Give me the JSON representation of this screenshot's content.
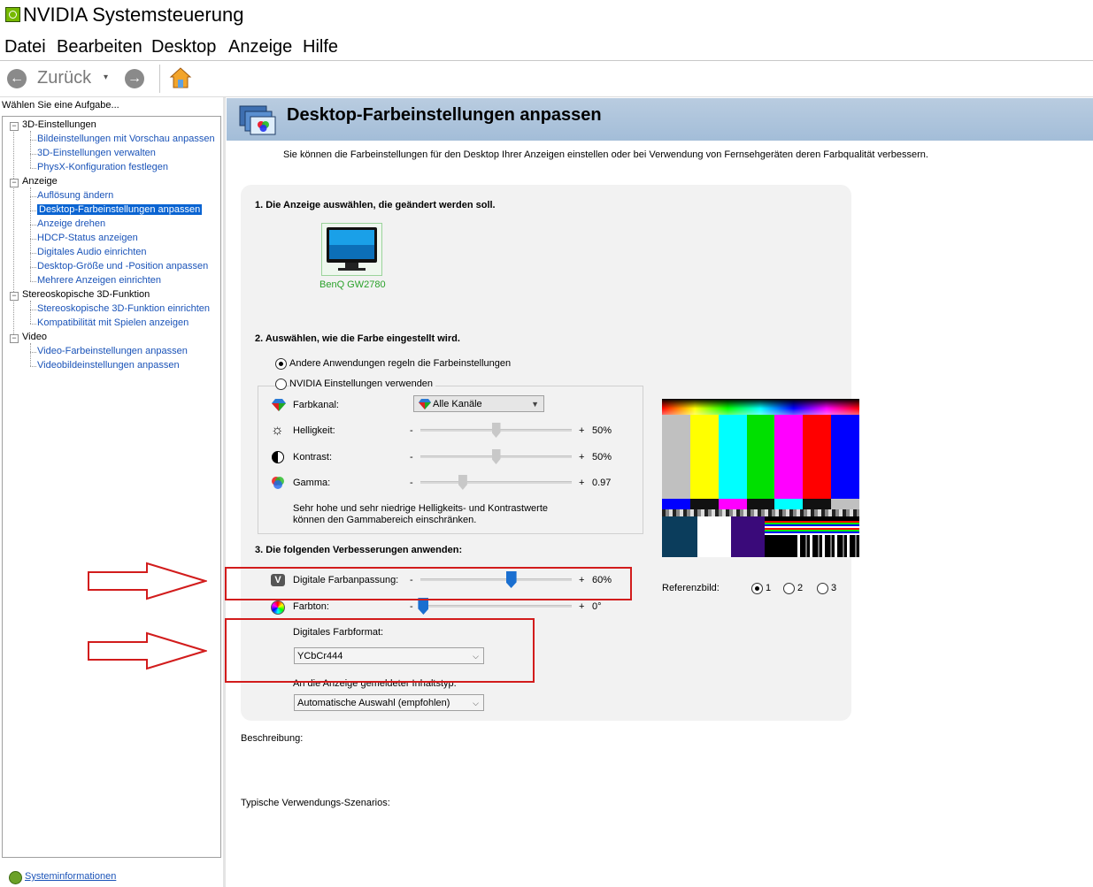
{
  "window": {
    "title": "NVIDIA Systemsteuerung"
  },
  "menu": [
    "Datei",
    "Bearbeiten",
    "Desktop",
    "Anzeige",
    "Hilfe"
  ],
  "toolbar": {
    "back_label": "Zurück",
    "back_dropdown": "▾"
  },
  "sidebar": {
    "heading": "Wählen Sie eine Aufgabe...",
    "tree": [
      {
        "label": "3D-Einstellungen",
        "level": 0
      },
      {
        "label": "Bildeinstellungen mit Vorschau anpassen",
        "level": 1
      },
      {
        "label": "3D-Einstellungen verwalten",
        "level": 1
      },
      {
        "label": "PhysX-Konfiguration festlegen",
        "level": 1
      },
      {
        "label": "Anzeige",
        "level": 0
      },
      {
        "label": "Auflösung ändern",
        "level": 1
      },
      {
        "label": "Desktop-Farbeinstellungen anpassen",
        "level": 1,
        "selected": true
      },
      {
        "label": "Anzeige drehen",
        "level": 1
      },
      {
        "label": "HDCP-Status anzeigen",
        "level": 1
      },
      {
        "label": "Digitales Audio einrichten",
        "level": 1
      },
      {
        "label": "Desktop-Größe und -Position anpassen",
        "level": 1
      },
      {
        "label": "Mehrere Anzeigen einrichten",
        "level": 1
      },
      {
        "label": "Stereoskopische 3D-Funktion",
        "level": 0
      },
      {
        "label": "Stereoskopische 3D-Funktion einrichten",
        "level": 1
      },
      {
        "label": "Kompatibilität mit Spielen anzeigen",
        "level": 1
      },
      {
        "label": "Video",
        "level": 0
      },
      {
        "label": "Video-Farbeinstellungen anpassen",
        "level": 1
      },
      {
        "label": "Videobildeinstellungen anpassen",
        "level": 1
      }
    ],
    "expander_symbol": "−",
    "sysinfo_label": "Systeminformationen"
  },
  "content": {
    "title": "Desktop-Farbeinstellungen anpassen",
    "intro": "Sie können die Farbeinstellungen für den Desktop Ihrer Anzeigen einstellen oder bei Verwendung von Fernsehgeräten deren Farbqualität verbessern.",
    "section1": "1. Die Anzeige auswählen, die geändert werden soll.",
    "monitor_name": "BenQ GW2780",
    "section2": "2. Auswählen, wie die Farbe eingestellt wird.",
    "radio_other": "Andere Anwendungen regeln die Farbeinstellungen",
    "radio_nvidia": "NVIDIA Einstellungen verwenden",
    "channel_label": "Farbkanal:",
    "channel_value": "Alle Kanäle",
    "brightness_label": "Helligkeit:",
    "brightness_value": "50%",
    "brightness_level": 0.5,
    "contrast_label": "Kontrast:",
    "contrast_value": "50%",
    "contrast_level": 0.5,
    "gamma_label": "Gamma:",
    "gamma_value": "0.97",
    "gamma_level": 0.28,
    "minus": "-",
    "plus": "+",
    "warning": "Sehr hohe und sehr niedrige Helligkeits- und Kontrastwerte können den Gammabereich einschränken.",
    "section3": "3. Die folgenden Verbesserungen anwenden:",
    "vibrance_label": "Digitale Farbanpassung:",
    "vibrance_value": "60%",
    "vibrance_level": 0.6,
    "hue_label": "Farbton:",
    "hue_value": "0°",
    "hue_level": 0.02,
    "color_format_label": "Digitales Farbformat:",
    "color_format_value": "YCbCr444",
    "content_type_label": "An die Anzeige gemeldeter Inhaltstyp:",
    "content_type_value": "Automatische Auswahl (empfohlen)",
    "reference_label": "Referenzbild:",
    "reference_options": [
      "1",
      "2",
      "3"
    ],
    "description_label": "Beschreibung:",
    "usage_label": "Typische Verwendungs-Szenarios:"
  },
  "colors": {
    "nvidia_green": "#76b900",
    "link_blue": "#1a53b8",
    "selection_blue": "#0a64d2",
    "header_band": "#a3bdd8",
    "annotation_red": "#d21c1c",
    "slider_blue": "#1a6fd0"
  }
}
